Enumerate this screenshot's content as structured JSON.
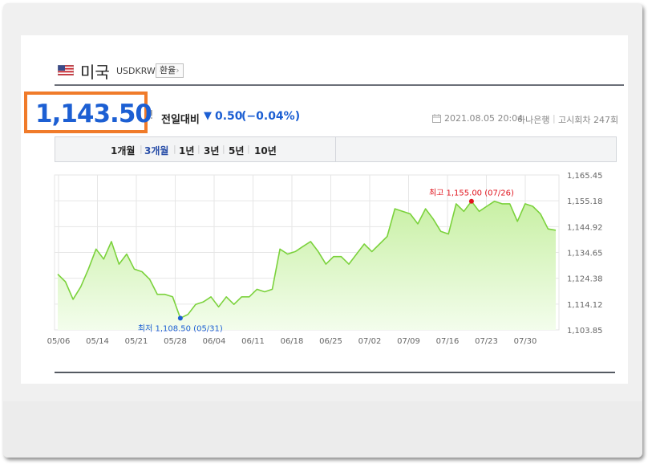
{
  "header": {
    "country": "미국",
    "code": "USDKRW",
    "exchange_button": "환율",
    "exchange_chevron": "›"
  },
  "price": {
    "current": "1,143.50",
    "excl": "!",
    "change_label": "전일대비",
    "change_arrow": "▼",
    "change_value": "0.50",
    "change_pct": "(−0.04%)",
    "date": "2021.08.05 20:04",
    "bank": "하나은행",
    "round_label": "고시회차 247회"
  },
  "periods": [
    {
      "label": "1개월",
      "active": false
    },
    {
      "label": "3개월",
      "active": true
    },
    {
      "label": "1년",
      "active": false
    },
    {
      "label": "3년",
      "active": false
    },
    {
      "label": "5년",
      "active": false
    },
    {
      "label": "10년",
      "active": false
    }
  ],
  "colors": {
    "price": "#1c5fd3",
    "highlight_border": "#f07b2a",
    "line": "#7bd23c",
    "area_top": "#c8f0a4",
    "area_bottom": "#f3fdec",
    "max_marker": "#e0141e",
    "min_marker": "#1c5fd3",
    "grid": "#e6e6e6"
  },
  "icons": {
    "flag": "us-flag-icon",
    "calendar": "calendar-icon"
  },
  "chart_data": {
    "type": "area",
    "x_ticks": [
      "05/06",
      "05/14",
      "05/21",
      "05/28",
      "06/04",
      "06/11",
      "06/18",
      "06/25",
      "07/02",
      "07/09",
      "07/16",
      "07/23",
      "07/30"
    ],
    "y_ticks": [
      "1,165.45",
      "1,155.18",
      "1,144.92",
      "1,134.65",
      "1,124.38",
      "1,114.12",
      "1,103.85"
    ],
    "ylim": [
      1103.85,
      1165.45
    ],
    "series": [
      {
        "values": [
          1126,
          1123,
          1116,
          1121,
          1128,
          1136,
          1132,
          1139,
          1130,
          1134,
          1128,
          1127,
          1124,
          1118,
          1118,
          1117,
          1108.5,
          1110,
          1114,
          1115,
          1117,
          1113,
          1117,
          1114,
          1117,
          1117,
          1120,
          1119,
          1120,
          1136,
          1134,
          1135,
          1137,
          1139,
          1135,
          1130,
          1133,
          1133,
          1130,
          1134,
          1138,
          1135,
          1138,
          1141,
          1152,
          1151,
          1150,
          1146,
          1152,
          1148,
          1143,
          1142,
          1154,
          1151,
          1155,
          1151,
          1153,
          1155,
          1154,
          1154,
          1147,
          1154,
          1153,
          1150,
          1144,
          1143.5
        ]
      }
    ],
    "annotations": {
      "max": {
        "label": "최고 1,155.00 (07/26)",
        "value": 1155
      },
      "min": {
        "label": "최저 1,108.50 (05/31)",
        "value": 1108.5
      }
    },
    "grid": true
  }
}
